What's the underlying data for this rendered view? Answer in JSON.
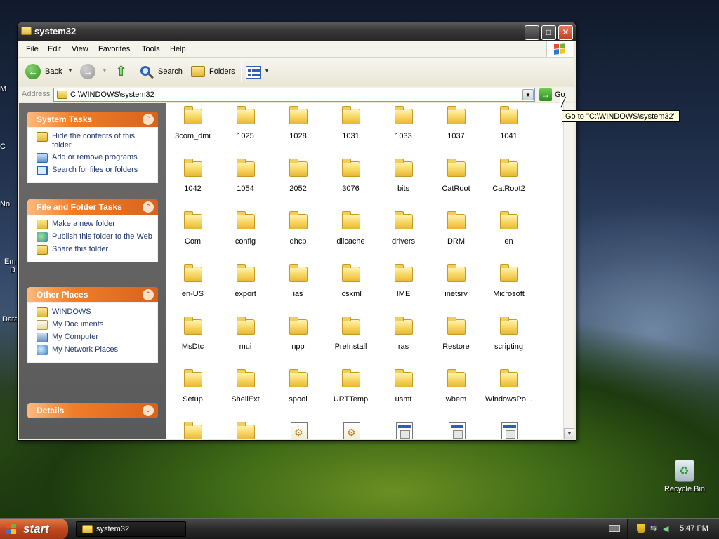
{
  "window": {
    "title": "system32",
    "menu": [
      "File",
      "Edit",
      "View",
      "Favorites",
      "Tools",
      "Help"
    ],
    "toolbar": {
      "back_label": "Back",
      "search_label": "Search",
      "folders_label": "Folders"
    },
    "address": {
      "label": "Address",
      "value": "C:\\WINDOWS\\system32",
      "go_label": "Go"
    },
    "tooltip": "Go to \"C:\\WINDOWS\\system32\""
  },
  "task_pane": {
    "system_tasks": {
      "title": "System Tasks",
      "items": [
        {
          "label": "Hide the contents of this folder",
          "icon": "folder-icon"
        },
        {
          "label": "Add or remove programs",
          "icon": "programs-icon"
        },
        {
          "label": "Search for files or folders",
          "icon": "search-icon"
        }
      ]
    },
    "file_folder_tasks": {
      "title": "File and Folder Tasks",
      "items": [
        {
          "label": "Make a new folder",
          "icon": "new-folder-icon"
        },
        {
          "label": "Publish this folder to the Web",
          "icon": "globe-icon"
        },
        {
          "label": "Share this folder",
          "icon": "share-icon"
        }
      ]
    },
    "other_places": {
      "title": "Other Places",
      "items": [
        {
          "label": "WINDOWS",
          "icon": "folder-icon"
        },
        {
          "label": "My Documents",
          "icon": "documents-icon"
        },
        {
          "label": "My Computer",
          "icon": "computer-icon"
        },
        {
          "label": "My Network Places",
          "icon": "network-icon"
        }
      ]
    },
    "details": {
      "title": "Details"
    }
  },
  "files": [
    "3com_dmi",
    "1025",
    "1028",
    "1031",
    "1033",
    "1037",
    "1041",
    "1042",
    "1054",
    "2052",
    "3076",
    "bits",
    "CatRoot",
    "CatRoot2",
    "Com",
    "config",
    "dhcp",
    "dllcache",
    "drivers",
    "DRM",
    "en",
    "en-US",
    "export",
    "ias",
    "icsxml",
    "IME",
    "inetsrv",
    "Microsoft",
    "MsDtc",
    "mui",
    "npp",
    "PreInstall",
    "ras",
    "Restore",
    "scripting",
    "Setup",
    "ShellExt",
    "spool",
    "URTTemp",
    "usmt",
    "wbem",
    "WindowsPo..."
  ],
  "desktop": {
    "recycle_bin_label": "Recycle Bin",
    "partial_labels": [
      "M",
      "C",
      "No",
      "Em",
      "D",
      "Data"
    ]
  },
  "taskbar": {
    "start_label": "start",
    "task_item": "system32",
    "clock": "5:47 PM"
  }
}
